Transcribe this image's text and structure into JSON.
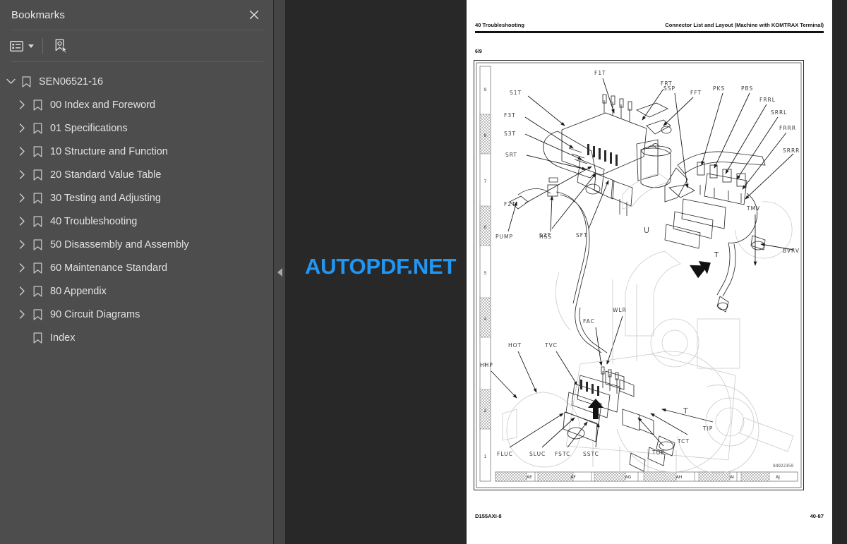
{
  "sidebar": {
    "title": "Bookmarks",
    "close_icon": "close-icon",
    "toolbar": {
      "options_label": "list-options-icon",
      "options_caret": "chevron-down-icon",
      "new_bookmark_label": "bookmark-pointer-icon"
    },
    "tree": [
      {
        "label": "SEN06521-16",
        "level": 0,
        "expanded": true,
        "has_children": true
      },
      {
        "label": "00 Index and Foreword",
        "level": 1,
        "expanded": false,
        "has_children": true
      },
      {
        "label": "01 Specifications",
        "level": 1,
        "expanded": false,
        "has_children": true
      },
      {
        "label": "10 Structure and Function",
        "level": 1,
        "expanded": false,
        "has_children": true
      },
      {
        "label": "20 Standard Value Table",
        "level": 1,
        "expanded": false,
        "has_children": true
      },
      {
        "label": "30 Testing and Adjusting",
        "level": 1,
        "expanded": false,
        "has_children": true
      },
      {
        "label": "40 Troubleshooting",
        "level": 1,
        "expanded": false,
        "has_children": true
      },
      {
        "label": "50 Disassembly and Assembly",
        "level": 1,
        "expanded": false,
        "has_children": true
      },
      {
        "label": "60 Maintenance Standard",
        "level": 1,
        "expanded": false,
        "has_children": true
      },
      {
        "label": "80 Appendix",
        "level": 1,
        "expanded": false,
        "has_children": true
      },
      {
        "label": "90 Circuit Diagrams",
        "level": 1,
        "expanded": false,
        "has_children": true
      },
      {
        "label": "Index",
        "level": 1,
        "expanded": false,
        "has_children": false
      }
    ],
    "collapse_handle": "collapse-sidebar-icon"
  },
  "viewer": {
    "watermark": "AUTOPDF.NET",
    "watermark_color": "#2196f3",
    "background_color": "#282828"
  },
  "document": {
    "header_left": "40 Troubleshooting",
    "header_right": "Connector List and Layout (Machine with KOMTRAX Terminal)",
    "sheet_number": "6/9",
    "footer_left": "D155AXI-8",
    "footer_right": "40-87",
    "drawing_number": "84D22350",
    "edge_ruler": [
      "9",
      "8",
      "7",
      "6",
      "5",
      "4",
      "3",
      "2",
      "1"
    ],
    "bottom_strip": [
      "AE",
      "AF",
      "AG",
      "AH",
      "AI",
      "AJ"
    ],
    "callouts": {
      "top_left_group": [
        "S1T",
        "F3T",
        "S3T",
        "SRT",
        "F2T",
        "S2T",
        "SFT",
        "F1T",
        "FRT",
        "FFT"
      ],
      "top_right_group": [
        "SSP",
        "PKS",
        "PBS",
        "FRRL",
        "SRRL",
        "FRRR",
        "SRRR",
        "BVRV"
      ],
      "middle_group": [
        "PUMP",
        "HSS",
        "TMV",
        "WLR",
        "FAC",
        "TVC",
        "HOT",
        "HHP"
      ],
      "bottom_group": [
        "FLUC",
        "SLUC",
        "FSTC",
        "SSTC",
        "TOP",
        "TCT",
        "TIP"
      ],
      "section_marks": [
        "U",
        "T",
        "T"
      ]
    }
  }
}
